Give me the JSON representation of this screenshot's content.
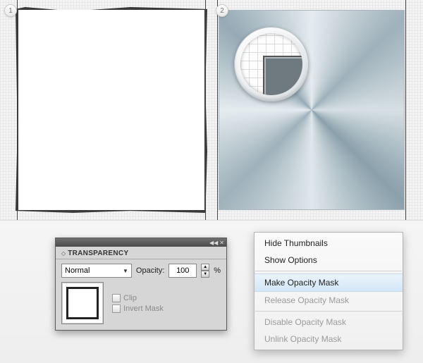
{
  "badges": {
    "one": "1",
    "two": "2"
  },
  "panel": {
    "tab_title": "TRANSPARENCY",
    "blend_mode": "Normal",
    "opacity_label": "Opacity:",
    "opacity_value": "100",
    "percent": "%",
    "clip_label": "Clip",
    "invert_label": "Invert Mask"
  },
  "menu": {
    "hide_thumbnails": "Hide Thumbnails",
    "show_options": "Show Options",
    "make_mask": "Make Opacity Mask",
    "release_mask": "Release Opacity Mask",
    "disable_mask": "Disable Opacity Mask",
    "unlink_mask": "Unlink Opacity Mask"
  }
}
